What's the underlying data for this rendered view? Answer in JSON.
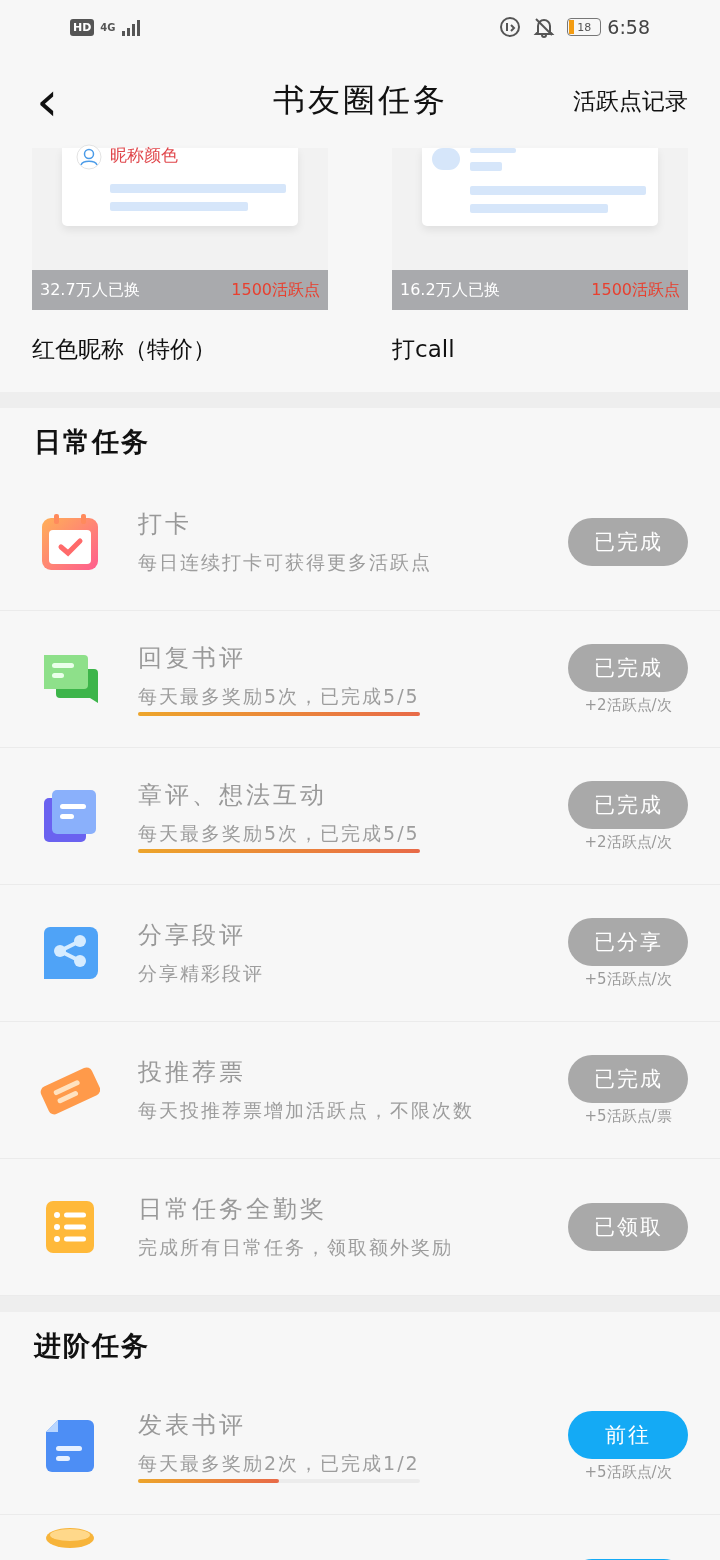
{
  "status_bar": {
    "hd": "HD",
    "network": "4G",
    "battery": "18",
    "time": "6:58"
  },
  "header": {
    "back": "‹",
    "title": "书友圈任务",
    "action": "活跃点记录"
  },
  "rewards": [
    {
      "kind": "nickname",
      "preview_text": "昵称颜色",
      "count": "32.7万人已换",
      "price": "1500活跃点",
      "name": "红色昵称（特价）"
    },
    {
      "kind": "call",
      "count": "16.2万人已换",
      "price": "1500活跃点",
      "name": "打call"
    }
  ],
  "sections": [
    {
      "title": "日常任务",
      "tasks": [
        {
          "kind": "calendar",
          "title": "打卡",
          "subtitle": "每日连续打卡可获得更多活跃点",
          "button": "已完成",
          "done": true
        },
        {
          "kind": "chat",
          "title": "回复书评",
          "subtitle": "每天最多奖励5次，已完成5/5",
          "level": 1,
          "button": "已完成",
          "done": true,
          "reward": "+2活跃点/次"
        },
        {
          "kind": "docs",
          "title": "章评、想法互动",
          "subtitle": "每天最多奖励5次，已完成5/5",
          "level": 1,
          "button": "已完成",
          "done": true,
          "reward": "+2活跃点/次"
        },
        {
          "kind": "share",
          "title": "分享段评",
          "subtitle": "分享精彩段评",
          "button": "已分享",
          "done": true,
          "reward": "+5活跃点/次"
        },
        {
          "kind": "ticket",
          "title": "投推荐票",
          "subtitle": "每天投推荐票增加活跃点，不限次数",
          "button": "已完成",
          "done": true,
          "reward": "+5活跃点/票"
        },
        {
          "kind": "list",
          "title": "日常任务全勤奖",
          "subtitle": "完成所有日常任务，领取额外奖励",
          "button": "已领取",
          "done": true
        }
      ]
    },
    {
      "title": "进阶任务",
      "tasks": [
        {
          "kind": "file",
          "title": "发表书评",
          "subtitle": "每天最多奖励2次，已完成1/2",
          "level": 0.5,
          "button": "前往",
          "done": false,
          "reward": "+5活跃点/次"
        },
        {
          "kind": "coin",
          "done": false
        }
      ]
    }
  ]
}
